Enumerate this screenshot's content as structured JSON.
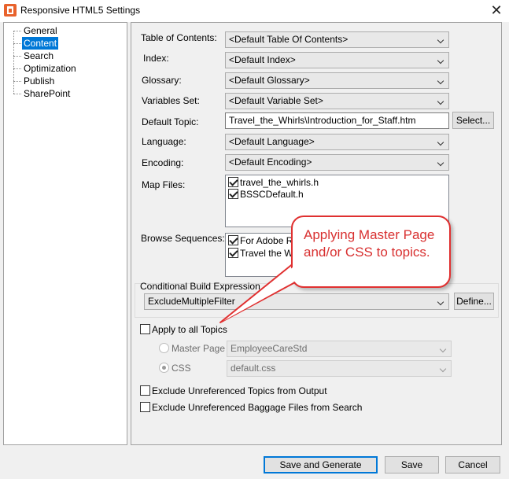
{
  "window": {
    "title": "Responsive HTML5 Settings",
    "close_glyph": "✕"
  },
  "icons": {
    "app": "app-icon",
    "close": "close-icon",
    "arrow": "chevron-down-icon"
  },
  "sidebar": {
    "items": [
      {
        "label": "General",
        "selected": false
      },
      {
        "label": "Content",
        "selected": true
      },
      {
        "label": "Search",
        "selected": false
      },
      {
        "label": "Optimization",
        "selected": false
      },
      {
        "label": "Publish",
        "selected": false
      },
      {
        "label": "SharePoint",
        "selected": false
      }
    ]
  },
  "content": {
    "toc": {
      "label": "Table of Contents:",
      "value": "<Default Table Of Contents>"
    },
    "index": {
      "label": "Index:",
      "value": "<Default Index>"
    },
    "glossary": {
      "label": "Glossary:",
      "value": "<Default Glossary>"
    },
    "variables": {
      "label": "Variables Set:",
      "value": "<Default Variable Set>"
    },
    "default_topic": {
      "label": "Default Topic:",
      "value": "Travel_the_Whirls\\Introduction_for_Staff.htm",
      "button": "Select..."
    },
    "language": {
      "label": "Language:",
      "value": "<Default Language>"
    },
    "encoding": {
      "label": "Encoding:",
      "value": "<Default Encoding>"
    },
    "map_files": {
      "label": "Map Files:",
      "items": [
        {
          "label": "travel_the_whirls.h",
          "checked": true
        },
        {
          "label": "BSSCDefault.h",
          "checked": true
        }
      ]
    },
    "browse_sequences": {
      "label": "Browse Sequences:",
      "items": [
        {
          "label": "For Adobe Ro",
          "checked": true
        },
        {
          "label": "Travel the Wh",
          "checked": true
        }
      ]
    },
    "conditional": {
      "label": "Conditional Build Expression",
      "value": "ExcludeMultipleFilter",
      "button": "Define..."
    },
    "apply_all": {
      "label": "Apply to all Topics",
      "checked": false
    },
    "master_page": {
      "label": "Master Page",
      "value": "EmployeeCareStd",
      "selected": false
    },
    "css": {
      "label": "CSS",
      "value": "default.css",
      "selected": true
    },
    "exclude_topics": {
      "label": "Exclude Unreferenced Topics from Output",
      "checked": false
    },
    "exclude_baggage": {
      "label": "Exclude Unreferenced Baggage Files from Search",
      "checked": false
    }
  },
  "callout": {
    "text": "Applying Master Page and/or CSS to topics.",
    "color": "#e03030"
  },
  "footer": {
    "save_generate": "Save and Generate",
    "save": "Save",
    "cancel": "Cancel"
  },
  "colors": {
    "selection": "#0078d7",
    "callout_border": "#e03030",
    "callout_text": "#d83030"
  }
}
